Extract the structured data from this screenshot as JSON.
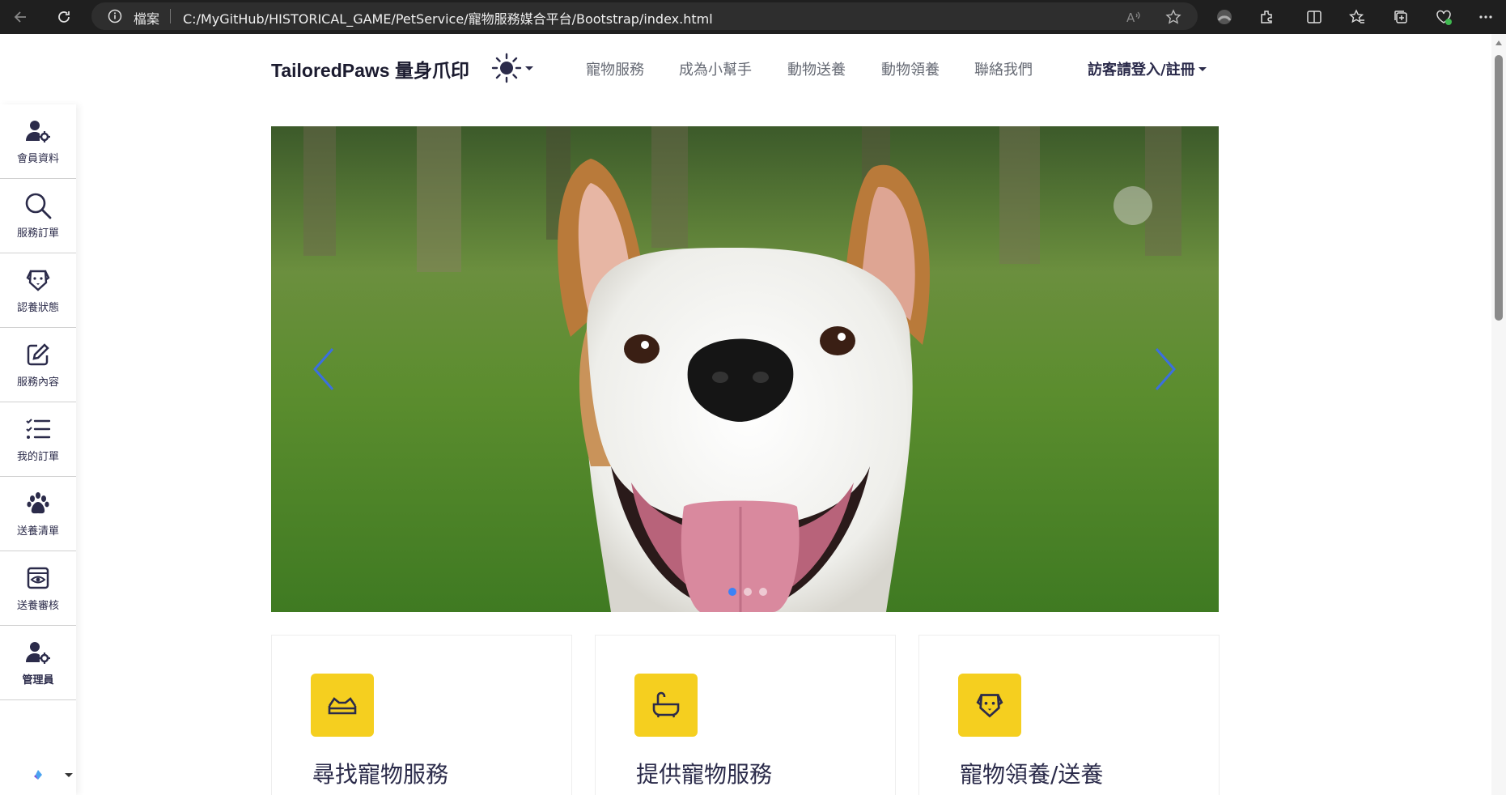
{
  "browser": {
    "file_label": "檔案",
    "url": "C:/MyGitHub/HISTORICAL_GAME/PetService/寵物服務媒合平台/Bootstrap/index.html"
  },
  "navbar": {
    "brand": "TailoredPaws 量身爪印",
    "links": [
      "寵物服務",
      "成為小幫手",
      "動物送養",
      "動物領養",
      "聯絡我們"
    ],
    "login": "訪客請登入/註冊"
  },
  "sidebar": {
    "items": [
      {
        "label": "會員資料",
        "icon": "user-gear-icon"
      },
      {
        "label": "服務訂單",
        "icon": "search-icon"
      },
      {
        "label": "認養狀態",
        "icon": "dog-icon"
      },
      {
        "label": "服務內容",
        "icon": "edit-icon"
      },
      {
        "label": "我的訂單",
        "icon": "list-check-icon"
      },
      {
        "label": "送養清單",
        "icon": "paw-icon"
      },
      {
        "label": "送養審核",
        "icon": "eye-icon"
      },
      {
        "label": "管理員",
        "icon": "user-gear-icon"
      }
    ]
  },
  "carousel": {
    "slides": 3,
    "active_slide": 1
  },
  "cards": [
    {
      "title": "尋找寵物服務",
      "icon": "pet-bed-icon"
    },
    {
      "title": "提供寵物服務",
      "icon": "bathtub-icon"
    },
    {
      "title": "寵物領養/送養",
      "icon": "dog-icon"
    }
  ],
  "colors": {
    "accent_yellow": "#f5cf1f",
    "navy": "#2b2b4a",
    "indicator_active": "#3b82f6"
  }
}
